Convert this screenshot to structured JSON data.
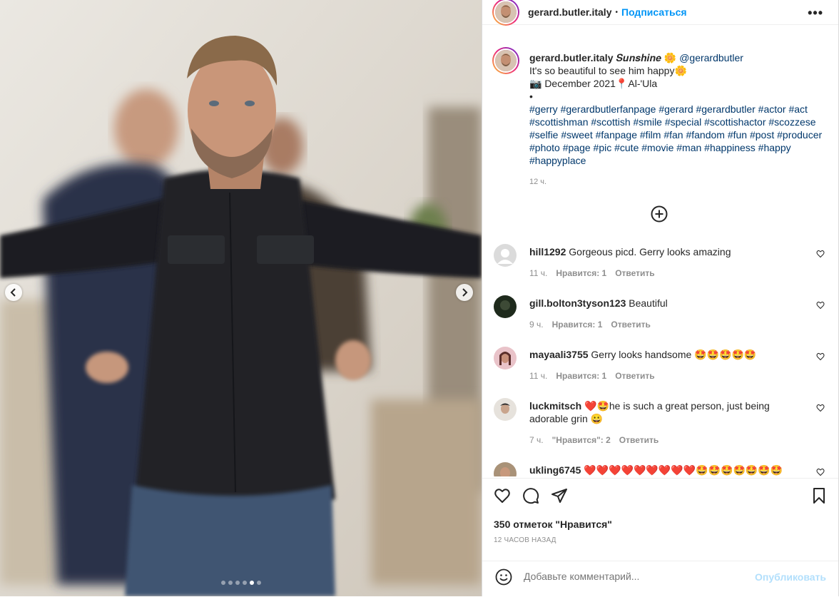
{
  "post": {
    "username": "gerard.butler.italy",
    "follow_separator": "•",
    "follow_label": "Подписаться",
    "more_label": "•••",
    "caption": {
      "username": "gerard.butler.italy",
      "title": "𝑺𝒖𝒏𝒔𝒉𝒊𝒏𝒆 🌼",
      "mention": "@gerardbutler",
      "line1": "It's so beautiful to see him happy🌼",
      "line2": "📷 December 2021📍Al-'Ula",
      "line3": "•",
      "hashtags": "#gerry #gerardbutlerfanpage #gerard #gerardbutler #actor #act #scottishman #scottish #smile #special #scottishactor #scozzese #selfie #sweet #fanpage #film #fan #fandom #fun #post #producer #photo #page #pic #cute #movie #man #happiness #happy #happyplace",
      "time": "12 ч."
    },
    "comments": [
      {
        "user": "hill1292",
        "text": "Gorgeous picd. Gerry looks amazing",
        "time": "11 ч.",
        "likes": "Нравится: 1",
        "reply": "Ответить"
      },
      {
        "user": "gill.bolton3tyson123",
        "text": "Beautiful",
        "time": "9 ч.",
        "likes": "Нравится: 1",
        "reply": "Ответить"
      },
      {
        "user": "mayaali3755",
        "text": "Gerry looks handsome 🤩🤩🤩🤩🤩",
        "time": "11 ч.",
        "likes": "Нравится: 1",
        "reply": "Ответить"
      },
      {
        "user": "luckmitsch",
        "text": "❤️🤩he is such a great person, just being adorable grin 😀",
        "time": "7 ч.",
        "likes": "\"Нравится\": 2",
        "reply": "Ответить"
      },
      {
        "user": "ukling6745",
        "text": "❤️❤️❤️❤️❤️❤️❤️❤️❤️🤩🤩🤩🤩🤩🤩🤩",
        "time": "",
        "likes": "",
        "reply": ""
      }
    ],
    "likes_text": "350 отметок \"Нравится\"",
    "posted_text": "12 ЧАСОВ НАЗАД",
    "composer": {
      "placeholder": "Добавьте комментарий...",
      "publish_label": "Опубликовать"
    },
    "carousel": {
      "total": 6,
      "active": 4
    }
  },
  "colors": {
    "link": "#00376b",
    "accent": "#0095f6",
    "muted": "#8e8e8e",
    "publish_disabled": "#b2dffc"
  }
}
